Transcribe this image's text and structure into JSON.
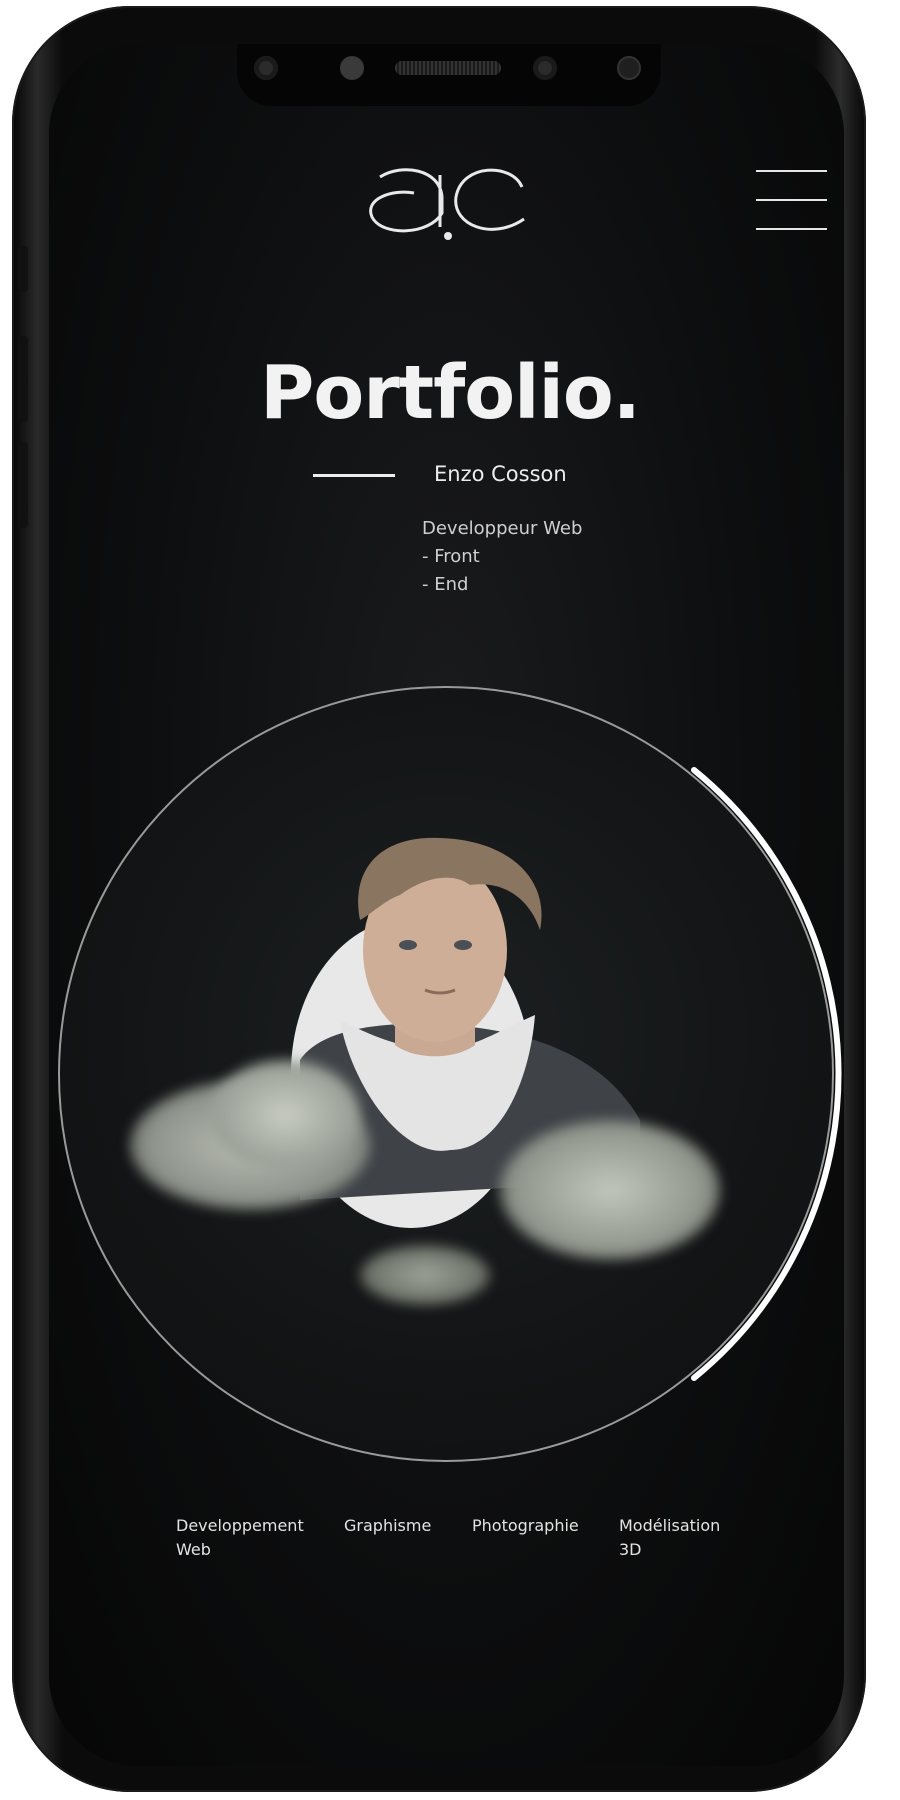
{
  "header": {
    "logo_text": "ƏC",
    "menu_icon": "hamburger-menu-icon"
  },
  "hero": {
    "title": "Portfolio.",
    "name": "Enzo Cosson",
    "role_lines": [
      "Developpeur Web",
      "- Front",
      "- End"
    ]
  },
  "categories": [
    {
      "label": "Developpement Web"
    },
    {
      "label": "Graphisme"
    },
    {
      "label": "Photographie"
    },
    {
      "label": "Modélisation 3D"
    }
  ],
  "colors": {
    "background": "#0d0e0f",
    "text": "#f2f2f2",
    "accent_line": "#ffffff"
  }
}
